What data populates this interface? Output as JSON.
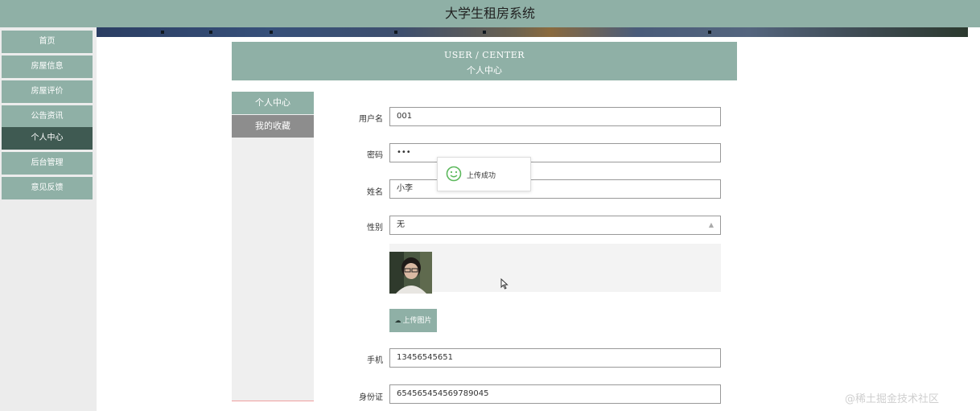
{
  "header": {
    "title": "大学生租房系统"
  },
  "sidebar": {
    "items": [
      {
        "label": "首页"
      },
      {
        "label": "房屋信息"
      },
      {
        "label": "房屋评价"
      },
      {
        "label": "公告资讯"
      },
      {
        "label": "个人中心",
        "active": true
      },
      {
        "label": "后台管理"
      },
      {
        "label": "意见反馈"
      }
    ]
  },
  "center": {
    "title_en": "USER / CENTER",
    "title_cn": "个人中心"
  },
  "subnav": {
    "personal": "个人中心",
    "favorites": "我的收藏"
  },
  "form": {
    "username": {
      "label": "用户名",
      "value": "001"
    },
    "password": {
      "label": "密码",
      "value": "•••"
    },
    "name": {
      "label": "姓名",
      "value": "小李"
    },
    "gender": {
      "label": "性别",
      "value": "无"
    },
    "upload_button": "上传图片",
    "phone": {
      "label": "手机",
      "value": "13456545651"
    },
    "id_card": {
      "label": "身份证",
      "value": "654565454569789045"
    }
  },
  "toast": {
    "message": "上传成功"
  },
  "watermark": "@稀土掘金技术社区",
  "icons": {
    "toast": "smile-icon",
    "upload": "upload-icon",
    "cursor": "mouse-cursor-icon"
  },
  "colors": {
    "accent": "#8fb0a6",
    "active": "#3f5a52",
    "secondary": "#8d8d8d"
  }
}
